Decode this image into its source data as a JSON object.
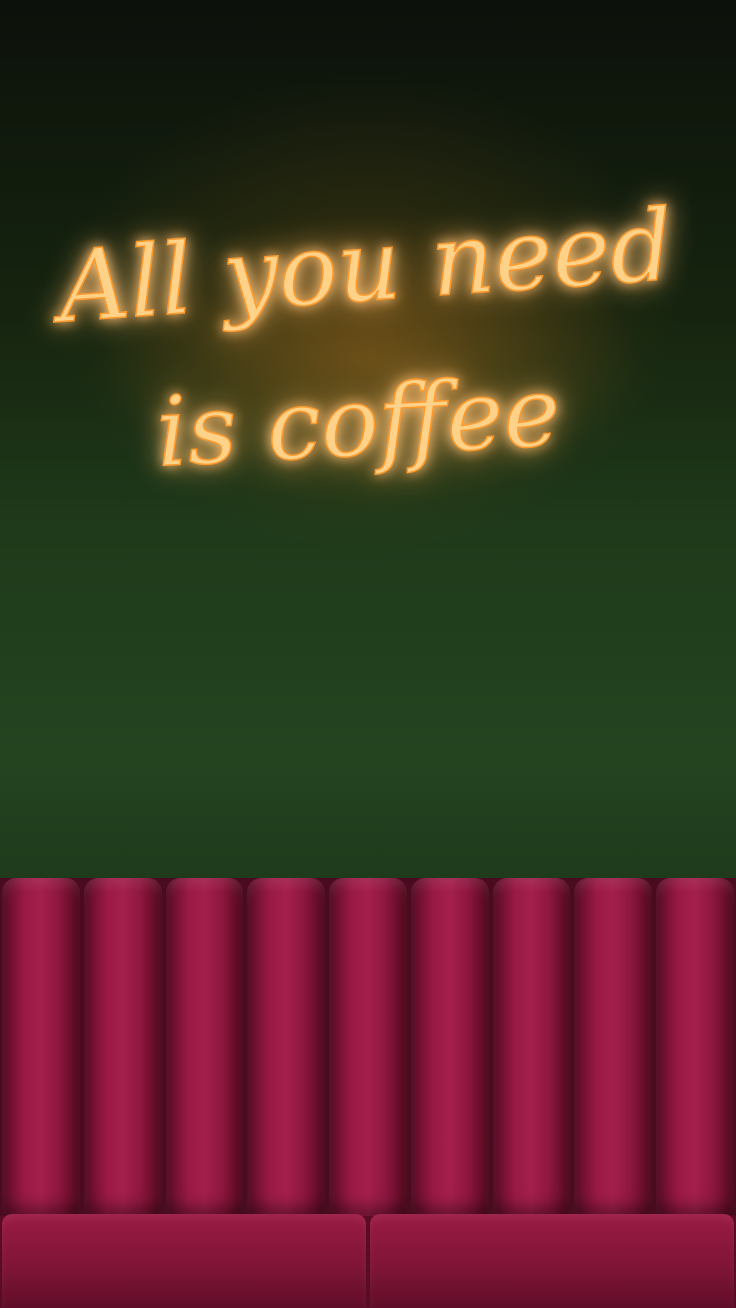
{
  "sign": {
    "line1": "All you need",
    "line2": "is coffee"
  },
  "colors": {
    "neon": "#ffb347",
    "neon_glow": "#ff8a1f",
    "foliage": "#244420",
    "sofa_velvet": "#8e1740"
  }
}
